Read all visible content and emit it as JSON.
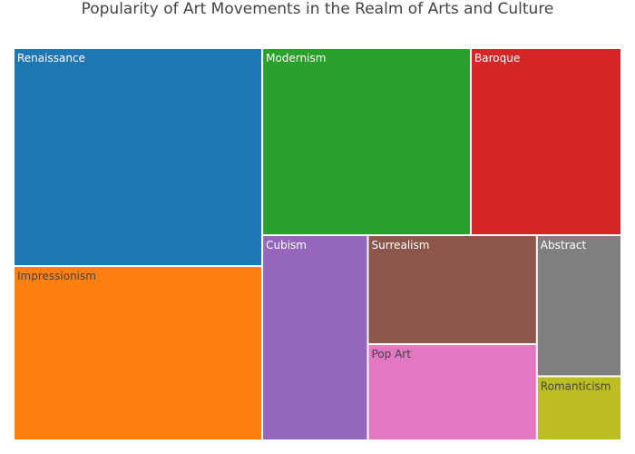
{
  "chart_data": {
    "type": "treemap",
    "title": "Popularity of Art Movements in the Realm of Arts and Culture",
    "items": [
      {
        "name": "Renaissance",
        "value": 25,
        "color": "#1f77b4",
        "label_color": "#ffffff"
      },
      {
        "name": "Impressionism",
        "value": 20,
        "color": "#ff7f0e",
        "label_color": "#444444"
      },
      {
        "name": "Modernism",
        "value": 18,
        "color": "#2ca02c",
        "label_color": "#ffffff"
      },
      {
        "name": "Baroque",
        "value": 13,
        "color": "#d62728",
        "label_color": "#ffffff"
      },
      {
        "name": "Cubism",
        "value": 10,
        "color": "#9467bd",
        "label_color": "#ffffff"
      },
      {
        "name": "Surrealism",
        "value": 8.5,
        "color": "#8c564b",
        "label_color": "#ffffff"
      },
      {
        "name": "Pop Art",
        "value": 7.5,
        "color": "#e377c2",
        "label_color": "#444444"
      },
      {
        "name": "Abstract",
        "value": 5.5,
        "color": "#7f7f7f",
        "label_color": "#ffffff"
      },
      {
        "name": "Romanticism",
        "value": 2.5,
        "color": "#bcbd22",
        "label_color": "#444444"
      }
    ]
  }
}
